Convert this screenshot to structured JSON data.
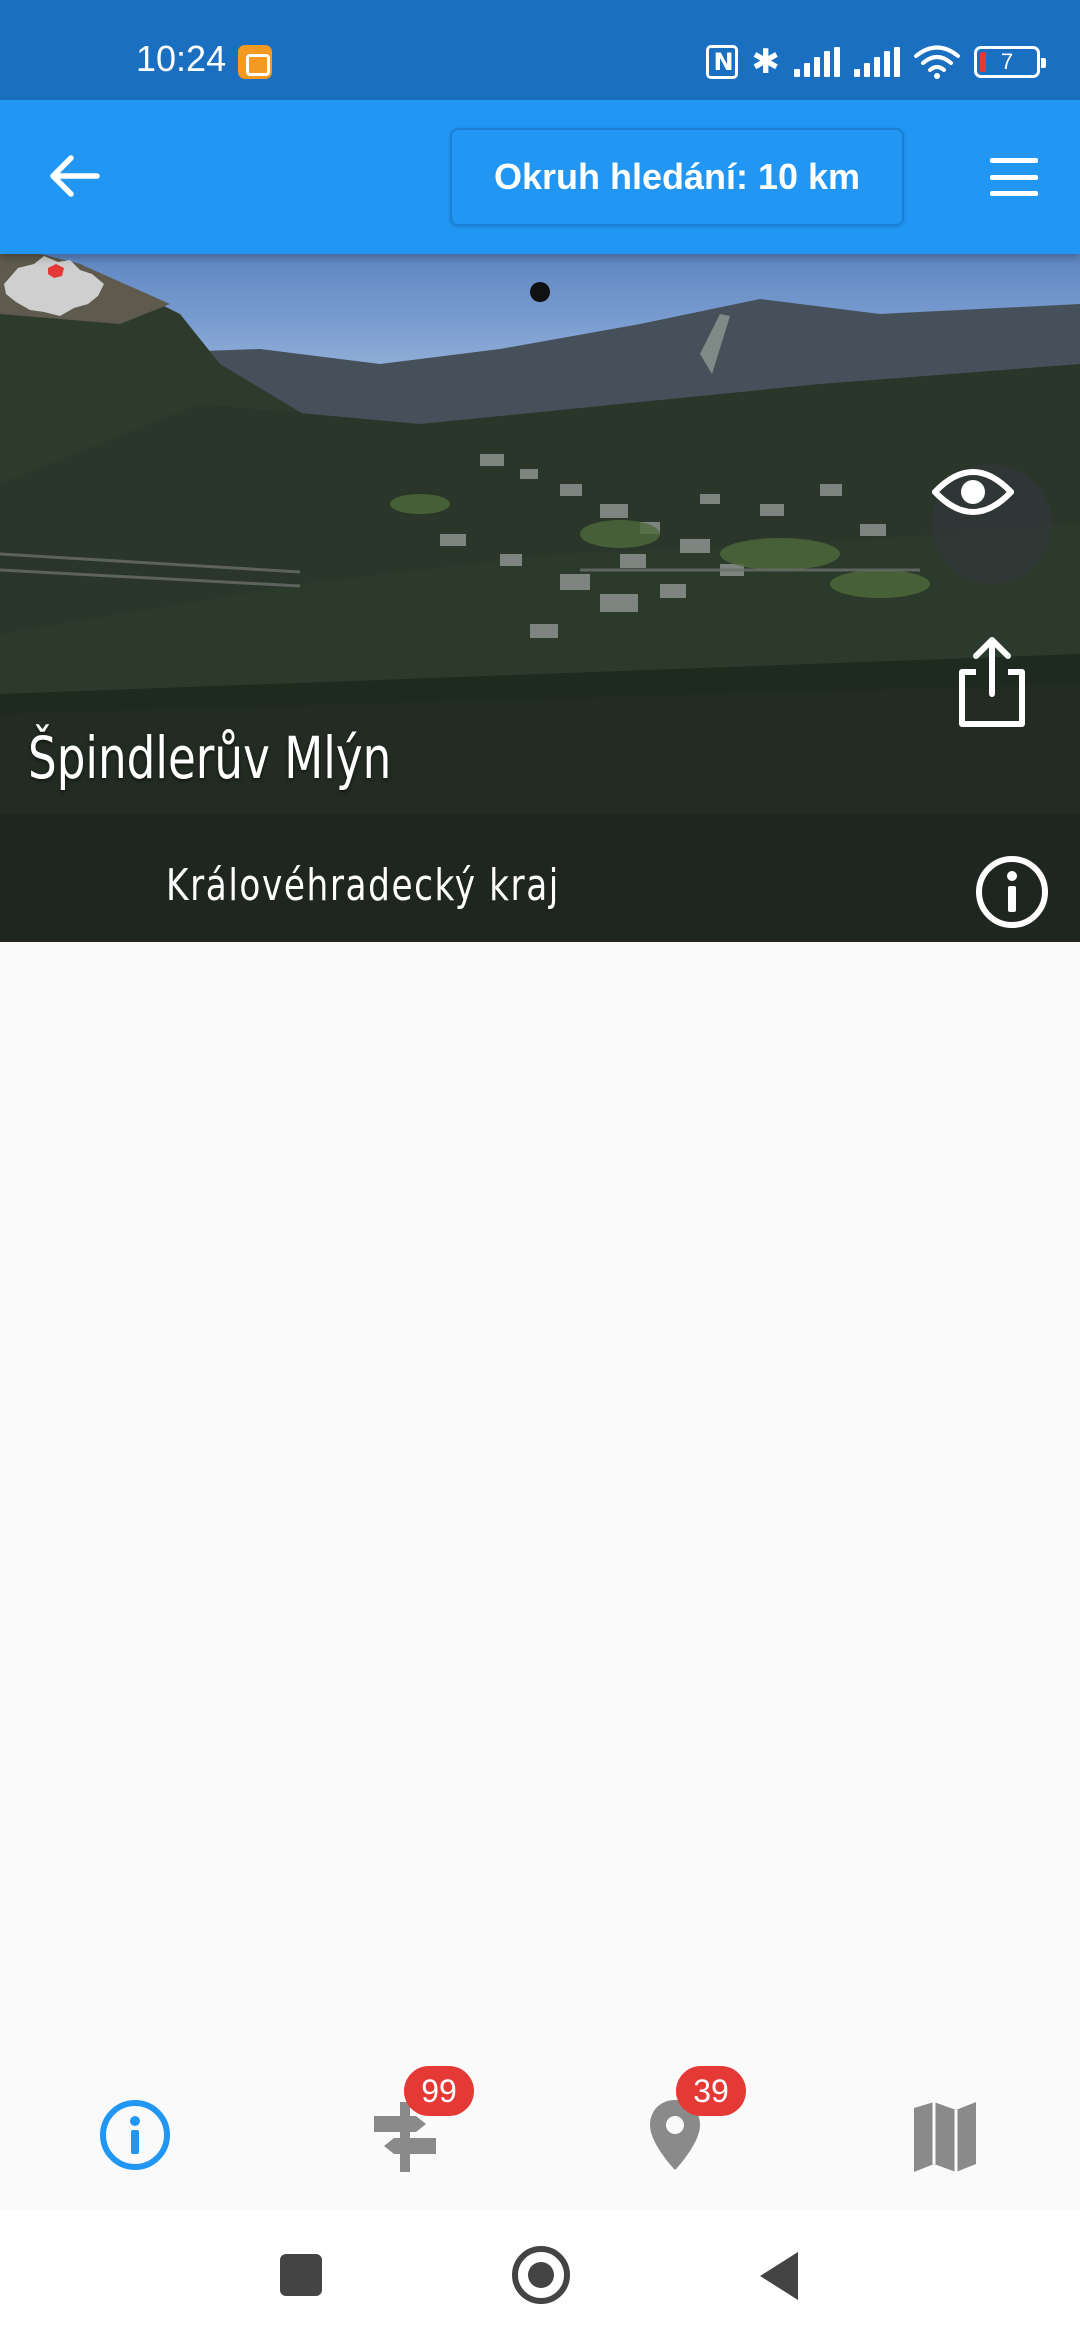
{
  "status_bar": {
    "time": "10:24",
    "battery_level": "7",
    "icons": [
      "app-notification-icon",
      "nfc-icon",
      "bluetooth-icon",
      "signal-icon",
      "signal-icon",
      "wifi-icon",
      "battery-icon"
    ]
  },
  "app_bar": {
    "back_icon": "arrow-back-icon",
    "search_radius_label": "Okruh hledání: 10 km",
    "menu_icon": "hamburger-menu-icon",
    "color": "#2196f3"
  },
  "hero": {
    "title": "Špindlerův Mlýn",
    "region": "Královéhradecký kraj",
    "page_indicator": {
      "current": 1,
      "total": 1
    },
    "actions": [
      "eye-icon",
      "share-icon",
      "info-icon"
    ]
  },
  "bottom_nav": {
    "items": [
      {
        "name": "info",
        "icon": "info-icon",
        "active": true,
        "badge": ""
      },
      {
        "name": "trails",
        "icon": "signpost-icon",
        "active": false,
        "badge": "99"
      },
      {
        "name": "places",
        "icon": "map-pin-icon",
        "active": false,
        "badge": "39"
      },
      {
        "name": "map",
        "icon": "map-icon",
        "active": false,
        "badge": ""
      }
    ],
    "active_color": "#2196f3",
    "inactive_color": "#8a8a8a",
    "badge_color": "#e53935"
  },
  "system_nav": {
    "buttons": [
      "recent-apps",
      "home",
      "back"
    ]
  }
}
